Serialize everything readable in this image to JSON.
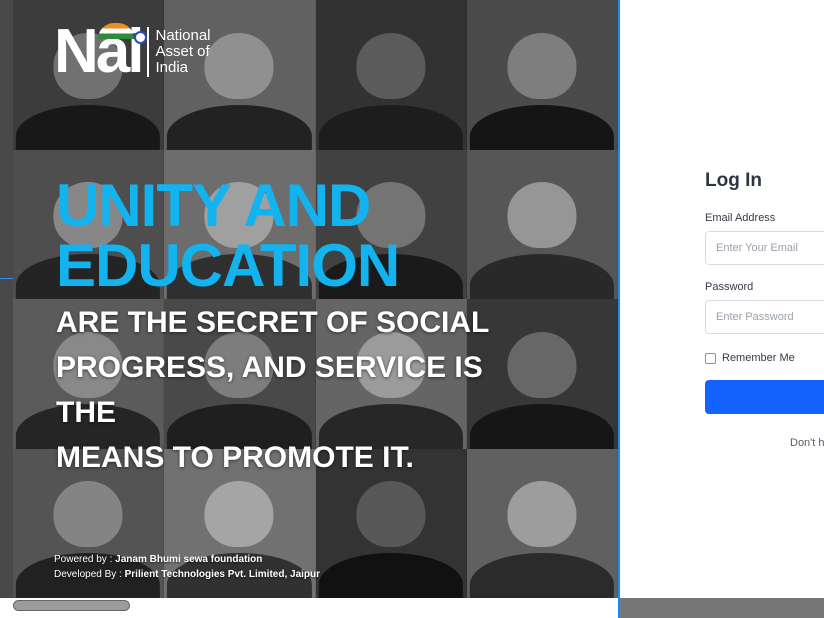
{
  "brand": {
    "mark": "Nai",
    "name_lines": [
      "National",
      "Asset of",
      "India"
    ]
  },
  "hero": {
    "headline_lines": [
      "UNITY AND",
      "EDUCATION"
    ],
    "subhead_lines": [
      "ARE THE SECRET OF SOCIAL",
      "PROGRESS, AND SERVICE IS THE",
      "MEANS TO PROMOTE IT."
    ],
    "powered_by_label": "Powered by : ",
    "powered_by_value": "Janam Bhumi sewa foundation",
    "developed_by_label": "Developed By : ",
    "developed_by_value": "Prilient Technologies Pvt. Limited, Jaipur"
  },
  "colors": {
    "headline": "#12b3ee",
    "primary_button": "#1463ff",
    "accent_line": "#1e88ff"
  },
  "login": {
    "title": "Log In",
    "email_label": "Email Address",
    "email_placeholder": "Enter Your Email",
    "password_label": "Password",
    "password_placeholder": "Enter Password",
    "remember_label": "Remember Me",
    "submit_label": "",
    "signup_prompt": "Don't h"
  }
}
